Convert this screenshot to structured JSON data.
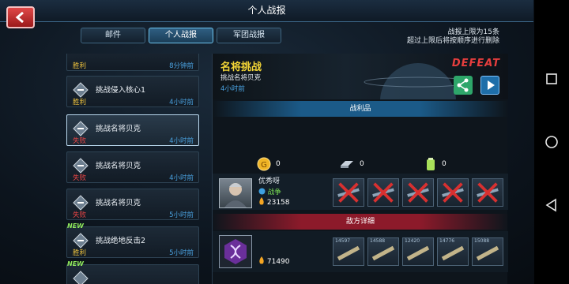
{
  "header": {
    "title": "个人战报",
    "back_label": "<"
  },
  "tabs": [
    {
      "label": "邮件",
      "active": false
    },
    {
      "label": "个人战报",
      "active": true
    },
    {
      "label": "军团战报",
      "active": false
    }
  ],
  "limit_note": {
    "line1": "战报上限为15条",
    "line2": "超过上限后将按顺序进行删除"
  },
  "reports": [
    {
      "name": "",
      "result": "胜利",
      "result_type": "win",
      "time": "8分钟前",
      "new": false
    },
    {
      "name": "挑战侵入核心1",
      "result": "胜利",
      "result_type": "win",
      "time": "4小时前",
      "new": false
    },
    {
      "name": "挑战名将贝克",
      "result": "失败",
      "result_type": "lose",
      "time": "4小时前",
      "new": false,
      "selected": true
    },
    {
      "name": "挑战名将贝克",
      "result": "失败",
      "result_type": "lose",
      "time": "4小时前",
      "new": false
    },
    {
      "name": "挑战名将贝克",
      "result": "失败",
      "result_type": "lose",
      "time": "5小时前",
      "new": false
    },
    {
      "name": "挑战绝地反击2",
      "result": "胜利",
      "result_type": "win",
      "time": "5小时前",
      "new": true
    },
    {
      "name": "",
      "result": "",
      "result_type": "win",
      "time": "",
      "new": true
    }
  ],
  "new_label": "NEW",
  "detail": {
    "title": "名将挑战",
    "subtitle": "挑战名将贝克",
    "time": "4小时前",
    "outcome": "DEFEAT",
    "loot_header": "战利品",
    "loot": [
      {
        "icon": "gold-coin-icon",
        "value": "0"
      },
      {
        "icon": "metal-ingot-icon",
        "value": "0"
      },
      {
        "icon": "fuel-canister-icon",
        "value": "0"
      }
    ],
    "player": {
      "name": "优秀呀",
      "stat": "战争",
      "power": "23158"
    },
    "enemy_header": "敌方详细",
    "enemy": {
      "power": "71490",
      "unit_power": [
        "14597",
        "14588",
        "12420",
        "14776",
        "15088"
      ]
    }
  },
  "colors": {
    "accent": "#6ec4ee",
    "win": "#f2c53e",
    "lose": "#e84545",
    "defeat": "#e63e3e",
    "time": "#4aa2e0"
  }
}
